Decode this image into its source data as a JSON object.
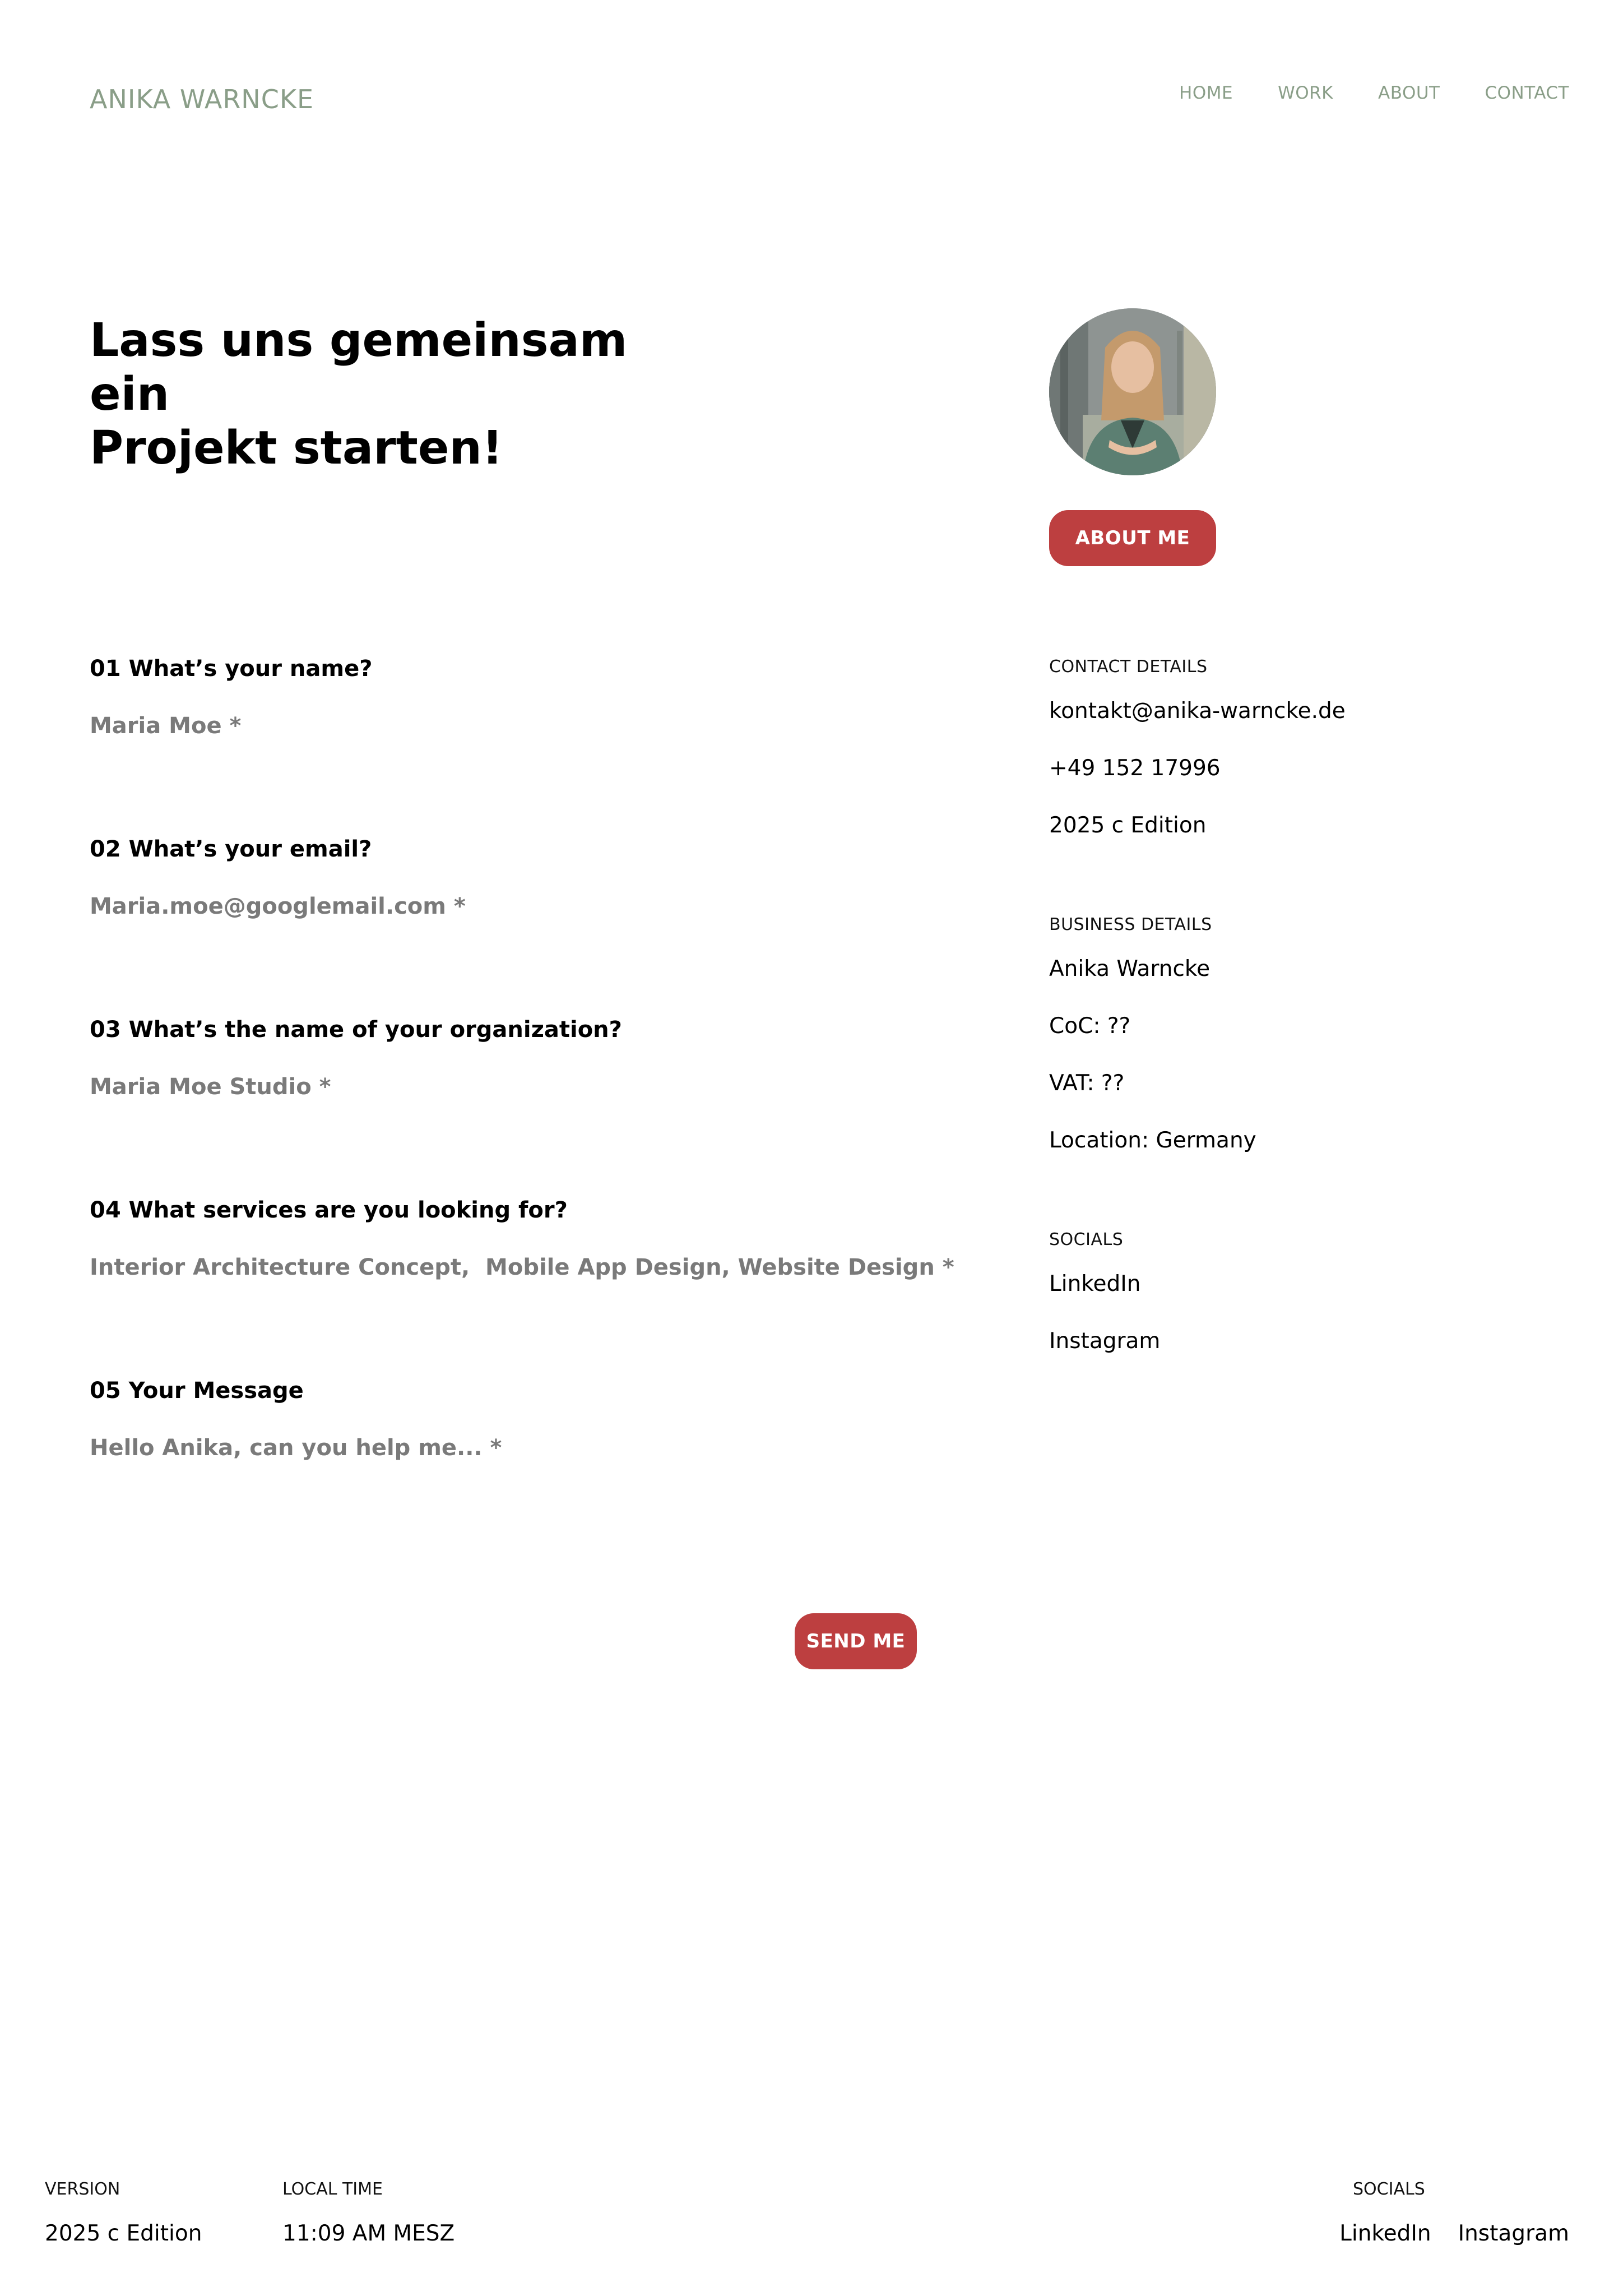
{
  "header": {
    "brand": "ANIKA WARNCKE",
    "nav": [
      "HOME",
      "WORK",
      "ABOUT",
      "CONTACT"
    ]
  },
  "hero": {
    "title_line1": "Lass uns gemeinsam ein",
    "title_line2": "Projekt starten!",
    "about_button": "ABOUT ME"
  },
  "form": {
    "questions": [
      {
        "label": "01 What’s your name?",
        "placeholder": "Maria Moe *"
      },
      {
        "label": "02 What’s your email?",
        "placeholder": "Maria.moe@googlemail.com *"
      },
      {
        "label": "03 What’s the name of your organization?",
        "placeholder": "Maria Moe Studio *"
      },
      {
        "label": "04 What services are you looking for?",
        "placeholder": "Interior Architecture Concept,  Mobile App Design, Website Design *"
      },
      {
        "label": "05 Your Message",
        "placeholder": "Hello Anika, can you help me... *"
      }
    ],
    "submit": "SEND ME"
  },
  "sidebar": {
    "contact": {
      "heading": "CONTACT DETAILS",
      "email": "kontakt@anika-warncke.de",
      "phone": "+49 152 17996",
      "edition": "2025 c Edition"
    },
    "business": {
      "heading": "BUSINESS DETAILS",
      "name": "Anika Warncke",
      "coc": "CoC: ??",
      "vat": "VAT: ??",
      "location": "Location: Germany"
    },
    "socials": {
      "heading": "SOCIALS",
      "links": [
        "LinkedIn",
        "Instagram"
      ]
    }
  },
  "footer": {
    "version_heading": "VERSION",
    "version_value": "2025 c Edition",
    "time_heading": "LOCAL TIME",
    "time_value": "11:09 AM MESZ",
    "socials_heading": "SOCIALS",
    "socials": [
      "LinkedIn",
      "Instagram"
    ]
  },
  "colors": {
    "brand_green": "#8a9e88",
    "accent_red": "#bd3f40",
    "placeholder_gray": "#7a7a7a"
  }
}
